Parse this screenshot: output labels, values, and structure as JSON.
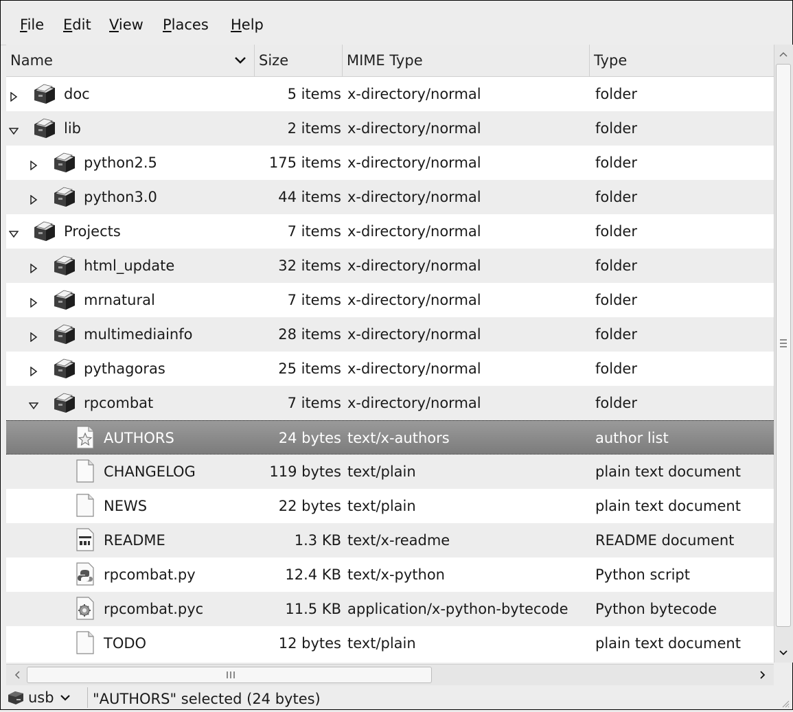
{
  "menubar": [
    {
      "label": "File",
      "mnemonic": "F",
      "rest": "ile"
    },
    {
      "label": "Edit",
      "mnemonic": "E",
      "rest": "dit"
    },
    {
      "label": "View",
      "mnemonic": "V",
      "rest": "iew"
    },
    {
      "label": "Places",
      "mnemonic": "P",
      "rest": "laces"
    },
    {
      "label": "Help",
      "mnemonic": "H",
      "rest": "elp"
    }
  ],
  "columns": {
    "name": "Name",
    "size": "Size",
    "mime": "MIME Type",
    "type": "Type"
  },
  "rows": [
    {
      "name": "doc",
      "size": "5 items",
      "mime": "x-directory/normal",
      "type": "folder",
      "depth": 0,
      "expander": "collapsed",
      "icon": "folder-icon"
    },
    {
      "name": "lib",
      "size": "2 items",
      "mime": "x-directory/normal",
      "type": "folder",
      "depth": 0,
      "expander": "expanded",
      "icon": "folder-icon"
    },
    {
      "name": "python2.5",
      "size": "175 items",
      "mime": "x-directory/normal",
      "type": "folder",
      "depth": 1,
      "expander": "collapsed",
      "icon": "folder-icon"
    },
    {
      "name": "python3.0",
      "size": "44 items",
      "mime": "x-directory/normal",
      "type": "folder",
      "depth": 1,
      "expander": "collapsed",
      "icon": "folder-icon"
    },
    {
      "name": "Projects",
      "size": "7 items",
      "mime": "x-directory/normal",
      "type": "folder",
      "depth": 0,
      "expander": "expanded",
      "icon": "folder-icon"
    },
    {
      "name": "html_update",
      "size": "32 items",
      "mime": "x-directory/normal",
      "type": "folder",
      "depth": 1,
      "expander": "collapsed",
      "icon": "folder-icon"
    },
    {
      "name": "mrnatural",
      "size": "7 items",
      "mime": "x-directory/normal",
      "type": "folder",
      "depth": 1,
      "expander": "collapsed",
      "icon": "folder-icon"
    },
    {
      "name": "multimediainfo",
      "size": "28 items",
      "mime": "x-directory/normal",
      "type": "folder",
      "depth": 1,
      "expander": "collapsed",
      "icon": "folder-icon"
    },
    {
      "name": "pythagoras",
      "size": "25 items",
      "mime": "x-directory/normal",
      "type": "folder",
      "depth": 1,
      "expander": "collapsed",
      "icon": "folder-icon"
    },
    {
      "name": "rpcombat",
      "size": "7 items",
      "mime": "x-directory/normal",
      "type": "folder",
      "depth": 1,
      "expander": "expanded",
      "icon": "folder-icon"
    },
    {
      "name": "AUTHORS",
      "size": "24 bytes",
      "mime": "text/x-authors",
      "type": "author list",
      "depth": 2,
      "expander": "none",
      "icon": "authors-file-icon",
      "selected": true
    },
    {
      "name": "CHANGELOG",
      "size": "119 bytes",
      "mime": "text/plain",
      "type": "plain text document",
      "depth": 2,
      "expander": "none",
      "icon": "text-file-icon"
    },
    {
      "name": "NEWS",
      "size": "22 bytes",
      "mime": "text/plain",
      "type": "plain text document",
      "depth": 2,
      "expander": "none",
      "icon": "text-file-icon"
    },
    {
      "name": "README",
      "size": "1.3 KB",
      "mime": "text/x-readme",
      "type": "README document",
      "depth": 2,
      "expander": "none",
      "icon": "readme-file-icon"
    },
    {
      "name": "rpcombat.py",
      "size": "12.4 KB",
      "mime": "text/x-python",
      "type": "Python script",
      "depth": 2,
      "expander": "none",
      "icon": "python-file-icon"
    },
    {
      "name": "rpcombat.pyc",
      "size": "11.5 KB",
      "mime": "application/x-python-bytecode",
      "type": "Python bytecode",
      "depth": 2,
      "expander": "none",
      "icon": "bytecode-file-icon"
    },
    {
      "name": "TODO",
      "size": "12 bytes",
      "mime": "text/plain",
      "type": "plain text document",
      "depth": 2,
      "expander": "none",
      "icon": "text-file-icon"
    }
  ],
  "statusbar": {
    "location": "usb",
    "text": "\"AUTHORS\" selected (24 bytes)"
  }
}
